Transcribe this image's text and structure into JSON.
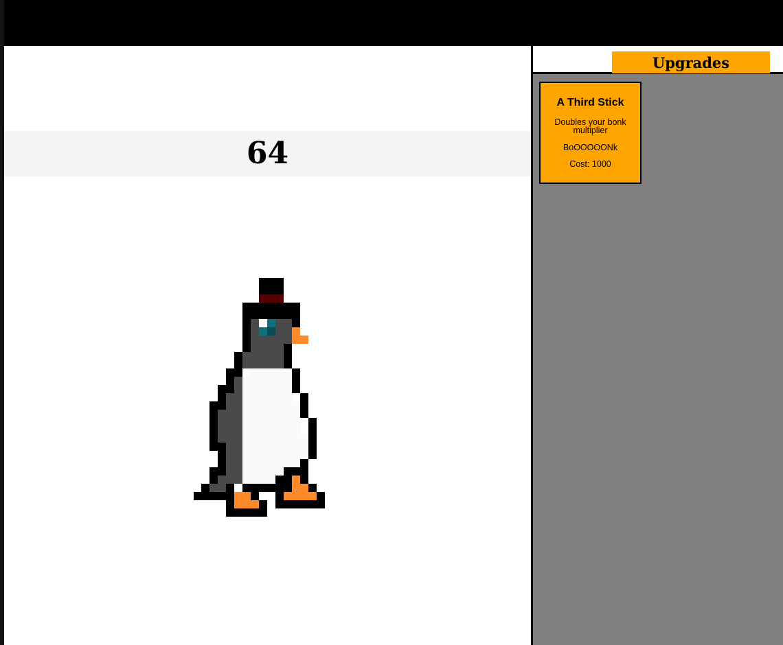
{
  "game": {
    "counter": "64"
  },
  "sidebar": {
    "title": "Upgrades",
    "upgrades": [
      {
        "name": "A Third Stick",
        "description": "Doubles your bonk multiplier",
        "sound": "BoOOOOONk",
        "cost": "Cost: 1000"
      }
    ]
  },
  "colors": {
    "accent": "#ffa500",
    "sidebar_bg": "#808080",
    "counter_bg": "#f4f4f4",
    "penguin_belly": "#fafafa",
    "penguin_body": "#4a4a4a",
    "penguin_beak_feet": "#ff8a2a",
    "penguin_eye": "#0e6f7f",
    "hat_band": "#5a0000"
  },
  "icons": {
    "clicker": "penguin-with-top-hat-icon"
  }
}
